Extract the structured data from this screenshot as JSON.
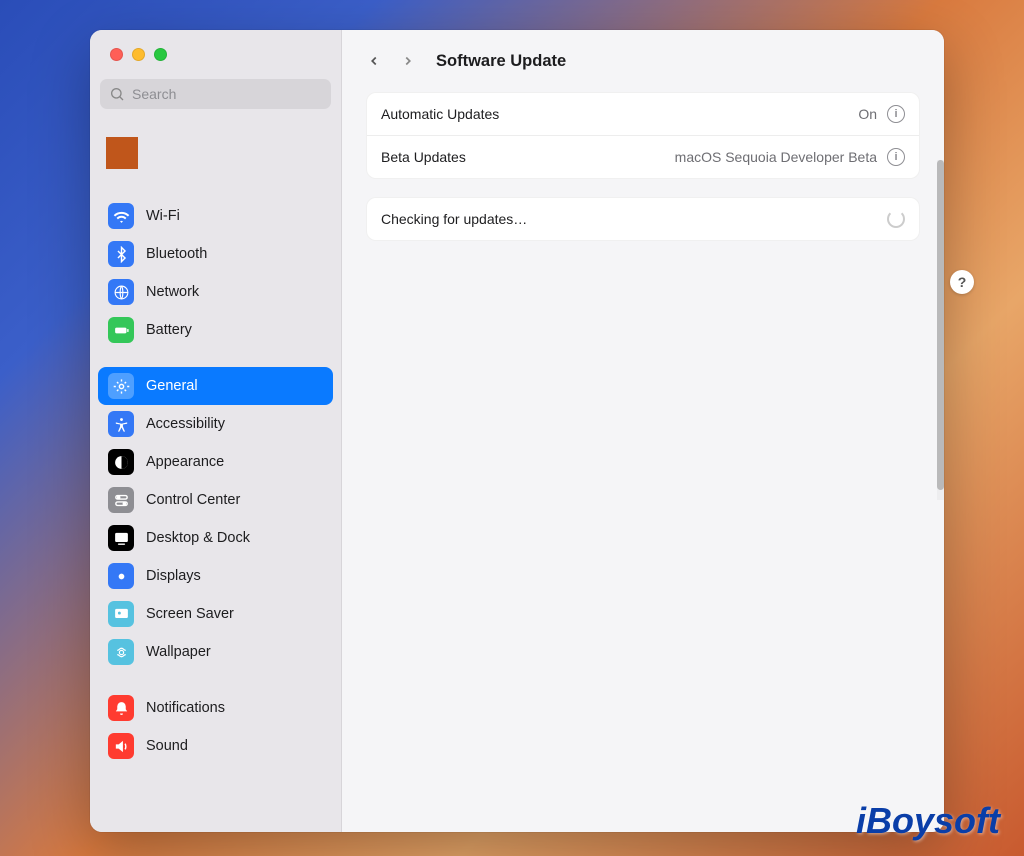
{
  "window": {
    "title": "Software Update"
  },
  "search": {
    "placeholder": "Search"
  },
  "sidebar": {
    "groups": [
      {
        "items": [
          {
            "name": "wifi",
            "label": "Wi-Fi",
            "iconBg": "#3478f6",
            "selected": false
          },
          {
            "name": "bluetooth",
            "label": "Bluetooth",
            "iconBg": "#3478f6",
            "selected": false
          },
          {
            "name": "network",
            "label": "Network",
            "iconBg": "#3478f6",
            "selected": false
          },
          {
            "name": "battery",
            "label": "Battery",
            "iconBg": "#34c759",
            "selected": false
          }
        ]
      },
      {
        "items": [
          {
            "name": "general",
            "label": "General",
            "iconBg": "#8e8e93",
            "selected": true
          },
          {
            "name": "accessibility",
            "label": "Accessibility",
            "iconBg": "#3478f6",
            "selected": false
          },
          {
            "name": "appearance",
            "label": "Appearance",
            "iconBg": "#000000",
            "selected": false
          },
          {
            "name": "control-center",
            "label": "Control Center",
            "iconBg": "#8e8e93",
            "selected": false
          },
          {
            "name": "desktop-dock",
            "label": "Desktop & Dock",
            "iconBg": "#000000",
            "selected": false
          },
          {
            "name": "displays",
            "label": "Displays",
            "iconBg": "#3478f6",
            "selected": false
          },
          {
            "name": "screen-saver",
            "label": "Screen Saver",
            "iconBg": "#56c2e0",
            "selected": false
          },
          {
            "name": "wallpaper",
            "label": "Wallpaper",
            "iconBg": "#56c2e0",
            "selected": false
          }
        ]
      },
      {
        "items": [
          {
            "name": "notifications",
            "label": "Notifications",
            "iconBg": "#ff3b30",
            "selected": false
          },
          {
            "name": "sound",
            "label": "Sound",
            "iconBg": "#ff3b30",
            "selected": false
          }
        ]
      }
    ]
  },
  "content": {
    "rows": [
      {
        "key": "auto",
        "label": "Automatic Updates",
        "value": "On",
        "info": true
      },
      {
        "key": "beta",
        "label": "Beta Updates",
        "value": "macOS Sequoia Developer Beta",
        "info": true
      }
    ],
    "status": {
      "label": "Checking for updates…",
      "spinning": true
    }
  },
  "watermark": "iBoysoft"
}
